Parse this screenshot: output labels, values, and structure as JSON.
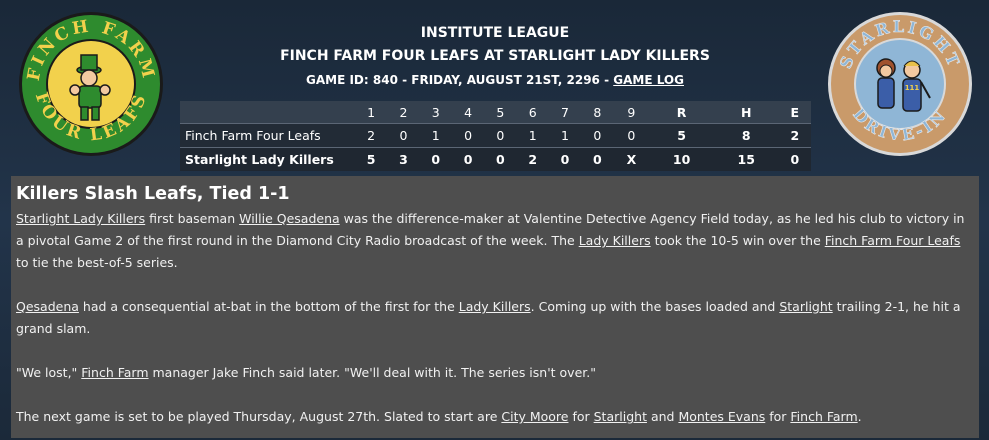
{
  "header": {
    "league": "INSTITUTE LEAGUE",
    "matchup": "FINCH FARM FOUR LEAFS AT STARLIGHT LADY KILLERS",
    "game_info": "GAME ID: 840 - FRIDAY, AUGUST 21ST, 2296 - ",
    "game_log_link": "GAME LOG"
  },
  "logos": {
    "away": {
      "ring_top": "FINCH FARM",
      "ring_bottom": "FOUR LEAFS",
      "colors": {
        "outer": "#2e8b2e",
        "inner": "#f2d14c"
      }
    },
    "home": {
      "ring_top": "STARLIGHT",
      "ring_bottom": "DRIVE-IN",
      "colors": {
        "outer": "#c99a6a",
        "inner": "#8fb6d6"
      }
    }
  },
  "linescore": {
    "headers": [
      "1",
      "2",
      "3",
      "4",
      "5",
      "6",
      "7",
      "8",
      "9",
      "R",
      "H",
      "E"
    ],
    "teams": [
      {
        "name": "Finch Farm Four Leafs",
        "innings": [
          "2",
          "0",
          "1",
          "0",
          "0",
          "1",
          "1",
          "0",
          "0"
        ],
        "r": "5",
        "h": "8",
        "e": "2"
      },
      {
        "name": "Starlight Lady Killers",
        "innings": [
          "5",
          "3",
          "0",
          "0",
          "0",
          "2",
          "0",
          "0",
          "X"
        ],
        "r": "10",
        "h": "15",
        "e": "0"
      }
    ]
  },
  "article": {
    "headline": "Killers Slash Leafs, Tied 1-1",
    "p1": {
      "l1": "Starlight Lady Killers",
      "t1": " first baseman ",
      "l2": "Willie Qesadena",
      "t2": " was the difference-maker at Valentine Detective Agency Field today, as he led his club to victory in a pivotal Game 2 of the first round in the Diamond City Radio broadcast of the week. The ",
      "l3": "Lady Killers",
      "t3": " took the 10-5 win over the ",
      "l4": "Finch Farm Four Leafs",
      "t4": " to tie the best-of-5 series."
    },
    "p2": {
      "l1": "Qesadena",
      "t1": " had a consequential at-bat in the bottom of the first for the ",
      "l2": "Lady Killers",
      "t2": ". Coming up with the bases loaded and ",
      "l3": "Starlight",
      "t3": " trailing 2-1, he hit a grand slam."
    },
    "p3": {
      "t0": "\"We lost,\" ",
      "l1": "Finch Farm",
      "t1": " manager Jake Finch said later. \"We'll deal with it. The series isn't over.\""
    },
    "p4": {
      "t0": "The next game is set to be played Thursday, August 27th. Slated to start are ",
      "l1": "City Moore",
      "t1": " for ",
      "l2": "Starlight",
      "t2": " and ",
      "l3": "Montes Evans",
      "t3": " for ",
      "l4": "Finch Farm",
      "t4": "."
    }
  }
}
